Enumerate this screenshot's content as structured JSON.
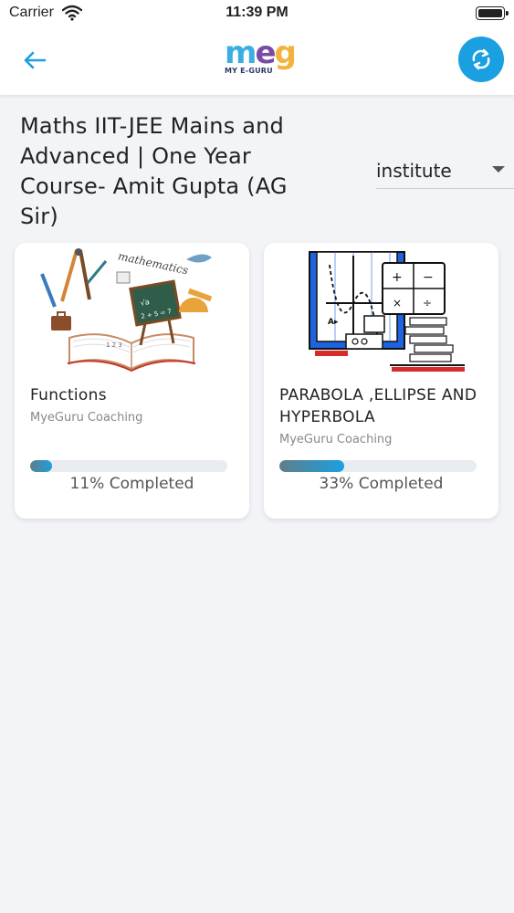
{
  "status_bar": {
    "carrier": "Carrier",
    "time": "11:39 PM"
  },
  "header": {
    "logo_text": "MY E-GURU",
    "logo_letters": [
      "m",
      "e",
      "g"
    ]
  },
  "course": {
    "title": "Maths IIT-JEE Mains and Advanced | One Year Course- Amit Gupta (AG Sir)"
  },
  "filter": {
    "selected": "institute"
  },
  "cards": [
    {
      "title": "Functions",
      "subtitle": "MyeGuru Coaching",
      "progress": 0.11,
      "progress_label": "11% Completed"
    },
    {
      "title": "PARABOLA ,ELLIPSE AND HYPERBOLA",
      "subtitle": "MyeGuru Coaching",
      "progress": 0.33,
      "progress_label": "33% Completed"
    }
  ],
  "colors": {
    "accent": "#1aa0e0",
    "background": "#f2f4f7",
    "progress_start": "#607d8b"
  },
  "icons": {
    "back": "arrow-left-icon",
    "refresh": "refresh-icon",
    "wifi": "wifi-icon",
    "battery": "battery-icon",
    "dropdown": "caret-down-icon"
  }
}
